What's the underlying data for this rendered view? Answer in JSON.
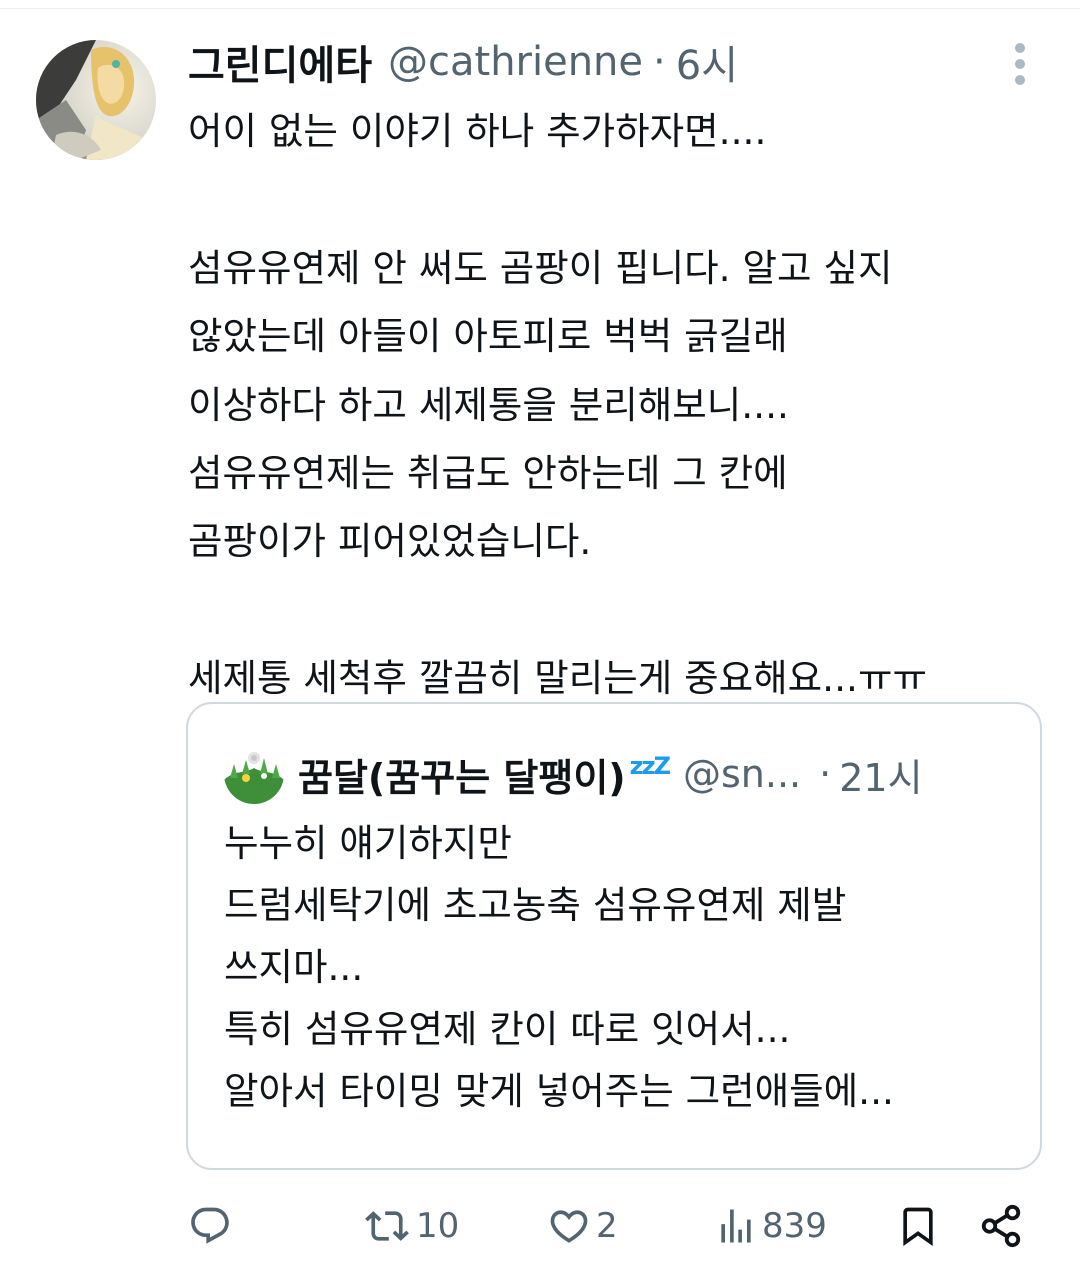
{
  "tweet": {
    "display_name": "그린디에타",
    "handle": "@cathrienne",
    "separator": "·",
    "time": "6시",
    "body": "어이 없는 이야기 하나 추가하자면....\n\n섬유유연제 안 써도 곰팡이 핍니다. 알고 싶지\n않았는데 아들이 아토피로 벅벅 긁길래\n이상하다 하고 세제통을 분리해보니....\n섬유유연제는 취급도 안하는데 그 칸에\n곰팡이가 피어있었습니다.\n\n세제통 세척후 깔끔히 말리는게 중요해요...ㅠㅠ"
  },
  "quote": {
    "display_name": "꿈달(꿈꾸는 달팽이)",
    "emoji": "zzZ",
    "handle": "@sn...",
    "separator": "·",
    "time": "21시",
    "body": "누누히 얘기하지만\n드럼세탁기에 초고농축 섬유유연제 제발\n쓰지마...\n특히 섬유유연제 칸이 따로 잇어서...\n알아서 타이밍 맞게 넣어주는 그런애들에..."
  },
  "actions": {
    "reply_count": "",
    "retweet_count": "10",
    "like_count": "2",
    "view_count": "839"
  },
  "colors": {
    "text": "#0f1419",
    "secondary": "#536471",
    "border": "#cfd9de",
    "accent": "#1d9bf0"
  },
  "icons": [
    "more-vertical-icon",
    "reply-icon",
    "retweet-icon",
    "heart-icon",
    "views-icon",
    "bookmark-icon",
    "share-icon"
  ]
}
